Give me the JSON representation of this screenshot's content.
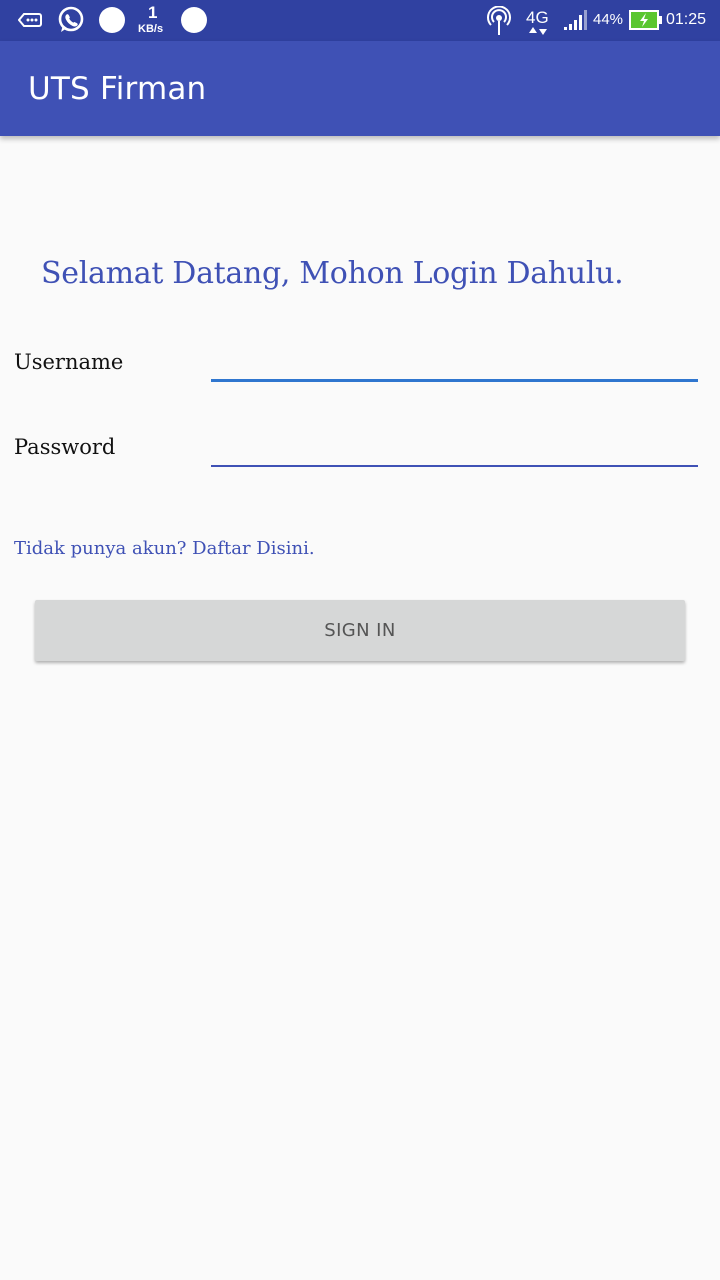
{
  "status_bar": {
    "network_speed_value": "1",
    "network_speed_unit": "KB/s",
    "network_type": "4G",
    "battery_percent": "44%",
    "time": "01:25",
    "icons": [
      "voicemail-icon",
      "whatsapp-icon",
      "notification-dot-icon",
      "notification-dot-icon",
      "hotspot-icon",
      "signal-icon",
      "battery-charging-icon"
    ]
  },
  "app_bar": {
    "title": "UTS Firman",
    "color": "#3f51b5"
  },
  "login": {
    "welcome_text": "Selamat Datang, Mohon Login Dahulu.",
    "username_label": "Username",
    "username_value": "",
    "password_label": "Password",
    "password_value": "",
    "register_link": "Tidak punya akun? Daftar Disini.",
    "signin_label": "SIGN IN"
  },
  "colors": {
    "primary": "#3f51b5",
    "status_bar": "#3041a1",
    "focused_underline": "#2f76cf",
    "button_bg": "#d6d7d7",
    "battery_charge": "#5ac62f"
  }
}
